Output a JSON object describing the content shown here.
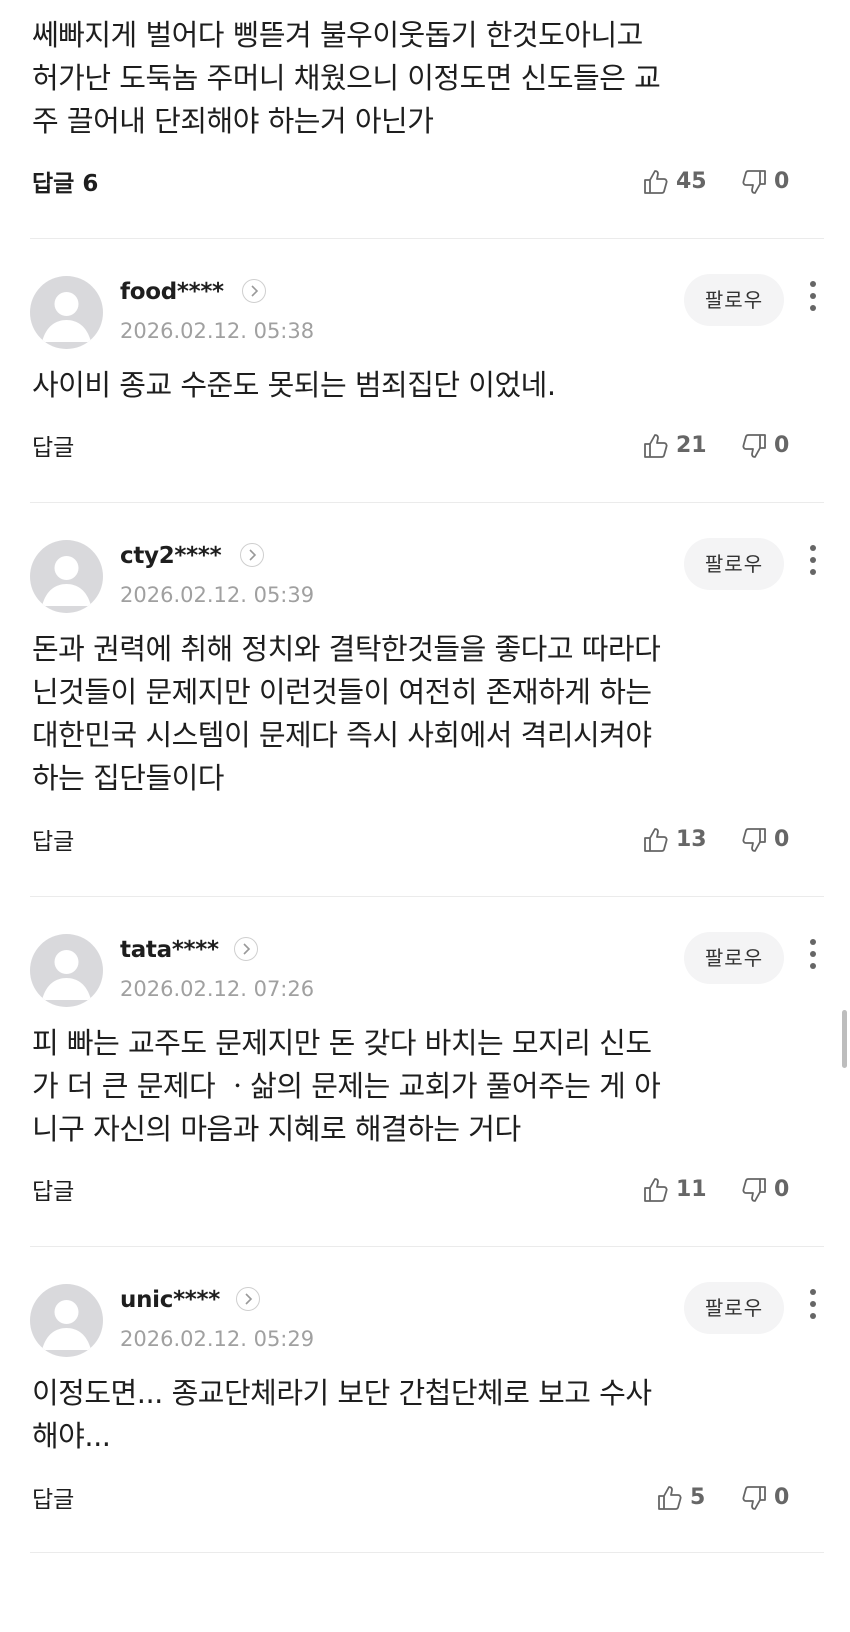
{
  "top_comment": {
    "body": "쎄빠지게 벌어다 삥뜯겨 불우이웃돕기 한것도아니고\n허가난 도둑놈 주머니 채웠으니 이정도면 신도들은 교\n주 끌어내 단죄해야 하는거 아닌가",
    "reply_label": "답글",
    "reply_count": "6",
    "likes": "45",
    "dislikes": "0"
  },
  "follow_label": "팔로우",
  "reply_label": "답글",
  "comments": [
    {
      "nickname": "food****",
      "date": "2026.02.12. 05:38",
      "body": "사이비 종교 수준도 못되는 범죄집단 이었네.",
      "likes": "21",
      "dislikes": "0"
    },
    {
      "nickname": "cty2****",
      "date": "2026.02.12. 05:39",
      "body": "돈과 권력에 취해 정치와 결탁한것들을 좋다고 따라다\n닌것들이 문제지만 이런것들이 여전히 존재하게 하는\n대한민국 시스템이 문제다 즉시 사회에서 격리시켜야\n하는 집단들이다",
      "likes": "13",
      "dislikes": "0"
    },
    {
      "nickname": "tata****",
      "date": "2026.02.12. 07:26",
      "body": "피 빠는 교주도 문제지만 돈 갖다 바치는 모지리 신도\n가 더 큰 문제다 ㆍ삶의 문제는 교회가 풀어주는 게 아\n니구 자신의 마음과 지혜로 해결하는 거다",
      "likes": "11",
      "dislikes": "0"
    },
    {
      "nickname": "unic****",
      "date": "2026.02.12. 05:29",
      "body": "이정도면... 종교단체라기 보단 간첩단체로 보고 수사\n해야...",
      "likes": "5",
      "dislikes": "0"
    }
  ],
  "icons": {
    "like": "thumbs-up-icon",
    "dislike": "thumbs-down-icon",
    "more": "more-vertical-icon",
    "profile": "chevron-right-circle-icon",
    "avatar": "default-avatar-icon"
  }
}
